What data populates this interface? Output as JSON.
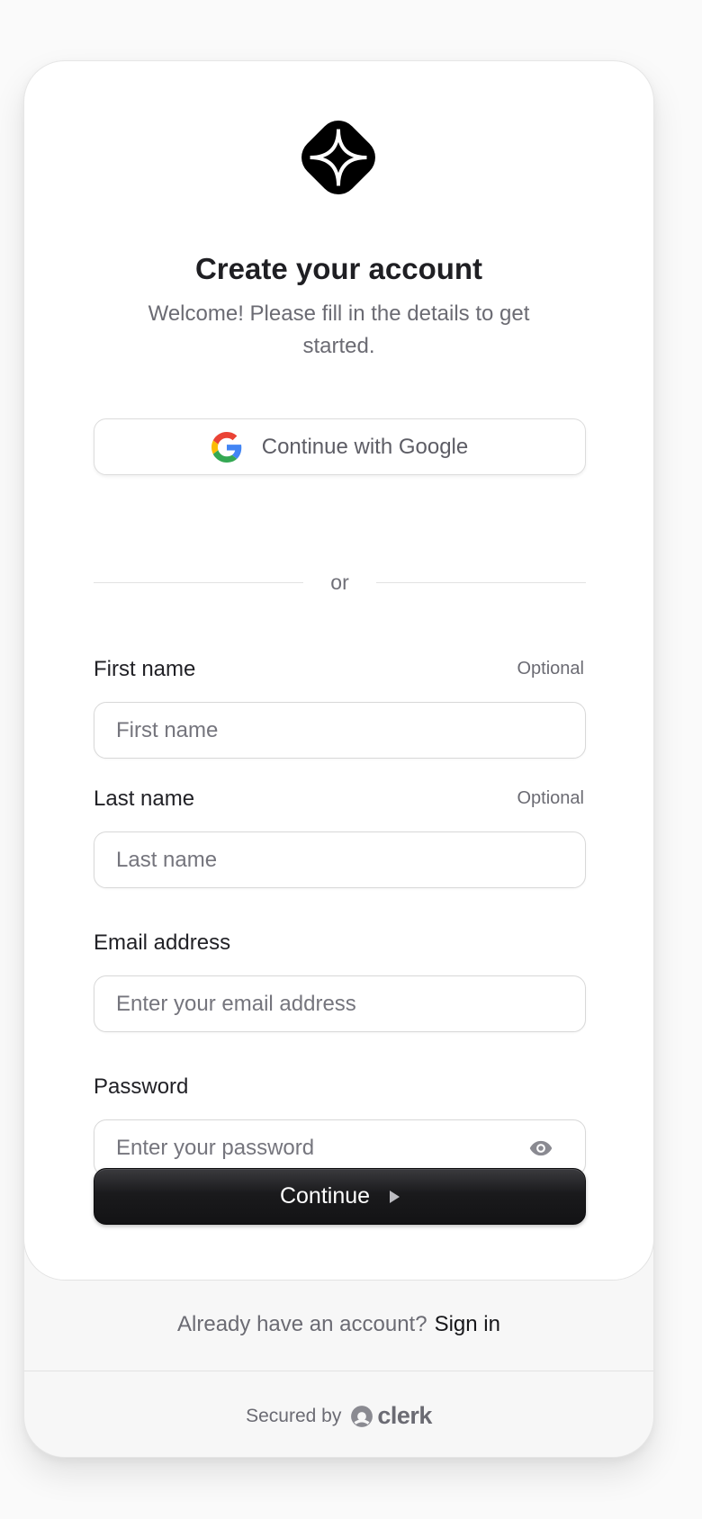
{
  "header": {
    "title": "Create your account",
    "subtitle": "Welcome! Please fill in the details to get started."
  },
  "social": {
    "google_label": "Continue with Google"
  },
  "divider": {
    "text": "or"
  },
  "fields": {
    "first_name": {
      "label": "First name",
      "optional": "Optional",
      "placeholder": "First name",
      "value": ""
    },
    "last_name": {
      "label": "Last name",
      "optional": "Optional",
      "placeholder": "Last name",
      "value": ""
    },
    "email": {
      "label": "Email address",
      "placeholder": "Enter your email address",
      "value": ""
    },
    "password": {
      "label": "Password",
      "placeholder": "Enter your password",
      "value": ""
    }
  },
  "actions": {
    "continue_label": "Continue"
  },
  "footer": {
    "prompt": "Already have an account?",
    "signin_label": "Sign in",
    "secured_by": "Secured by",
    "brand": "clerk"
  },
  "icons": {
    "logo": "app-logo-icon",
    "google": "google-icon",
    "password_toggle": "eye-icon",
    "continue_arrow": "triangle-right-icon",
    "brand": "clerk-logo-icon"
  },
  "colors": {
    "primary_button": "#1a1a1c",
    "card_background": "#ffffff",
    "footer_background": "#f7f7f7",
    "muted_text": "#6b6b73"
  }
}
